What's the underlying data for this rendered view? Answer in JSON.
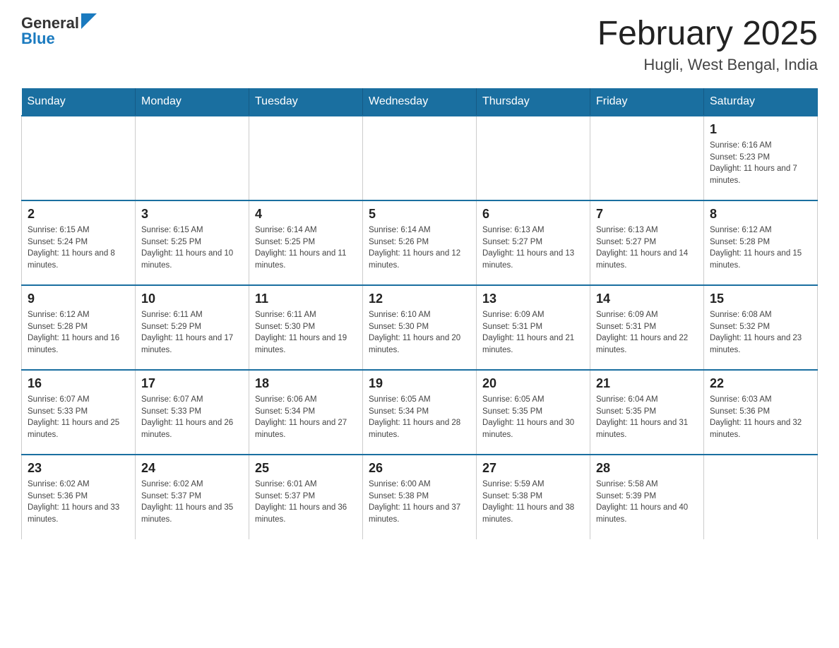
{
  "logo": {
    "general": "General",
    "blue": "Blue"
  },
  "header": {
    "title": "February 2025",
    "subtitle": "Hugli, West Bengal, India"
  },
  "weekdays": [
    "Sunday",
    "Monday",
    "Tuesday",
    "Wednesday",
    "Thursday",
    "Friday",
    "Saturday"
  ],
  "weeks": [
    [
      {
        "day": "",
        "sunrise": "",
        "sunset": "",
        "daylight": ""
      },
      {
        "day": "",
        "sunrise": "",
        "sunset": "",
        "daylight": ""
      },
      {
        "day": "",
        "sunrise": "",
        "sunset": "",
        "daylight": ""
      },
      {
        "day": "",
        "sunrise": "",
        "sunset": "",
        "daylight": ""
      },
      {
        "day": "",
        "sunrise": "",
        "sunset": "",
        "daylight": ""
      },
      {
        "day": "",
        "sunrise": "",
        "sunset": "",
        "daylight": ""
      },
      {
        "day": "1",
        "sunrise": "Sunrise: 6:16 AM",
        "sunset": "Sunset: 5:23 PM",
        "daylight": "Daylight: 11 hours and 7 minutes."
      }
    ],
    [
      {
        "day": "2",
        "sunrise": "Sunrise: 6:15 AM",
        "sunset": "Sunset: 5:24 PM",
        "daylight": "Daylight: 11 hours and 8 minutes."
      },
      {
        "day": "3",
        "sunrise": "Sunrise: 6:15 AM",
        "sunset": "Sunset: 5:25 PM",
        "daylight": "Daylight: 11 hours and 10 minutes."
      },
      {
        "day": "4",
        "sunrise": "Sunrise: 6:14 AM",
        "sunset": "Sunset: 5:25 PM",
        "daylight": "Daylight: 11 hours and 11 minutes."
      },
      {
        "day": "5",
        "sunrise": "Sunrise: 6:14 AM",
        "sunset": "Sunset: 5:26 PM",
        "daylight": "Daylight: 11 hours and 12 minutes."
      },
      {
        "day": "6",
        "sunrise": "Sunrise: 6:13 AM",
        "sunset": "Sunset: 5:27 PM",
        "daylight": "Daylight: 11 hours and 13 minutes."
      },
      {
        "day": "7",
        "sunrise": "Sunrise: 6:13 AM",
        "sunset": "Sunset: 5:27 PM",
        "daylight": "Daylight: 11 hours and 14 minutes."
      },
      {
        "day": "8",
        "sunrise": "Sunrise: 6:12 AM",
        "sunset": "Sunset: 5:28 PM",
        "daylight": "Daylight: 11 hours and 15 minutes."
      }
    ],
    [
      {
        "day": "9",
        "sunrise": "Sunrise: 6:12 AM",
        "sunset": "Sunset: 5:28 PM",
        "daylight": "Daylight: 11 hours and 16 minutes."
      },
      {
        "day": "10",
        "sunrise": "Sunrise: 6:11 AM",
        "sunset": "Sunset: 5:29 PM",
        "daylight": "Daylight: 11 hours and 17 minutes."
      },
      {
        "day": "11",
        "sunrise": "Sunrise: 6:11 AM",
        "sunset": "Sunset: 5:30 PM",
        "daylight": "Daylight: 11 hours and 19 minutes."
      },
      {
        "day": "12",
        "sunrise": "Sunrise: 6:10 AM",
        "sunset": "Sunset: 5:30 PM",
        "daylight": "Daylight: 11 hours and 20 minutes."
      },
      {
        "day": "13",
        "sunrise": "Sunrise: 6:09 AM",
        "sunset": "Sunset: 5:31 PM",
        "daylight": "Daylight: 11 hours and 21 minutes."
      },
      {
        "day": "14",
        "sunrise": "Sunrise: 6:09 AM",
        "sunset": "Sunset: 5:31 PM",
        "daylight": "Daylight: 11 hours and 22 minutes."
      },
      {
        "day": "15",
        "sunrise": "Sunrise: 6:08 AM",
        "sunset": "Sunset: 5:32 PM",
        "daylight": "Daylight: 11 hours and 23 minutes."
      }
    ],
    [
      {
        "day": "16",
        "sunrise": "Sunrise: 6:07 AM",
        "sunset": "Sunset: 5:33 PM",
        "daylight": "Daylight: 11 hours and 25 minutes."
      },
      {
        "day": "17",
        "sunrise": "Sunrise: 6:07 AM",
        "sunset": "Sunset: 5:33 PM",
        "daylight": "Daylight: 11 hours and 26 minutes."
      },
      {
        "day": "18",
        "sunrise": "Sunrise: 6:06 AM",
        "sunset": "Sunset: 5:34 PM",
        "daylight": "Daylight: 11 hours and 27 minutes."
      },
      {
        "day": "19",
        "sunrise": "Sunrise: 6:05 AM",
        "sunset": "Sunset: 5:34 PM",
        "daylight": "Daylight: 11 hours and 28 minutes."
      },
      {
        "day": "20",
        "sunrise": "Sunrise: 6:05 AM",
        "sunset": "Sunset: 5:35 PM",
        "daylight": "Daylight: 11 hours and 30 minutes."
      },
      {
        "day": "21",
        "sunrise": "Sunrise: 6:04 AM",
        "sunset": "Sunset: 5:35 PM",
        "daylight": "Daylight: 11 hours and 31 minutes."
      },
      {
        "day": "22",
        "sunrise": "Sunrise: 6:03 AM",
        "sunset": "Sunset: 5:36 PM",
        "daylight": "Daylight: 11 hours and 32 minutes."
      }
    ],
    [
      {
        "day": "23",
        "sunrise": "Sunrise: 6:02 AM",
        "sunset": "Sunset: 5:36 PM",
        "daylight": "Daylight: 11 hours and 33 minutes."
      },
      {
        "day": "24",
        "sunrise": "Sunrise: 6:02 AM",
        "sunset": "Sunset: 5:37 PM",
        "daylight": "Daylight: 11 hours and 35 minutes."
      },
      {
        "day": "25",
        "sunrise": "Sunrise: 6:01 AM",
        "sunset": "Sunset: 5:37 PM",
        "daylight": "Daylight: 11 hours and 36 minutes."
      },
      {
        "day": "26",
        "sunrise": "Sunrise: 6:00 AM",
        "sunset": "Sunset: 5:38 PM",
        "daylight": "Daylight: 11 hours and 37 minutes."
      },
      {
        "day": "27",
        "sunrise": "Sunrise: 5:59 AM",
        "sunset": "Sunset: 5:38 PM",
        "daylight": "Daylight: 11 hours and 38 minutes."
      },
      {
        "day": "28",
        "sunrise": "Sunrise: 5:58 AM",
        "sunset": "Sunset: 5:39 PM",
        "daylight": "Daylight: 11 hours and 40 minutes."
      },
      {
        "day": "",
        "sunrise": "",
        "sunset": "",
        "daylight": ""
      }
    ]
  ]
}
